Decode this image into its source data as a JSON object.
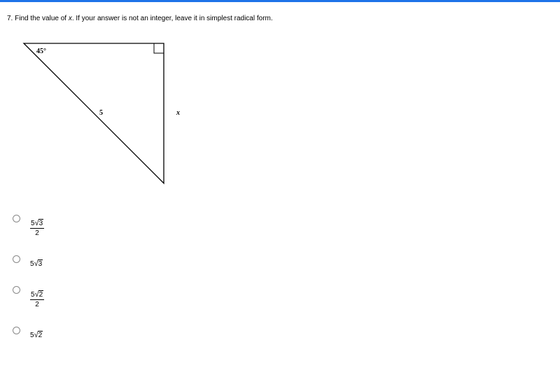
{
  "question": {
    "number": "7.",
    "text_before_x": "Find the value of ",
    "variable": "x",
    "text_after_x": ". If your answer is not an integer, leave it in simplest radical form."
  },
  "diagram": {
    "angle_label": "45°",
    "hypotenuse_label": "5",
    "side_label": "x"
  },
  "options": {
    "a": {
      "coef": "5",
      "radicand": "3",
      "denom": "2"
    },
    "b": {
      "coef": "5",
      "radicand": "3"
    },
    "c": {
      "coef": "5",
      "radicand": "2",
      "denom": "2"
    },
    "d": {
      "coef": "5",
      "radicand": "2"
    }
  }
}
